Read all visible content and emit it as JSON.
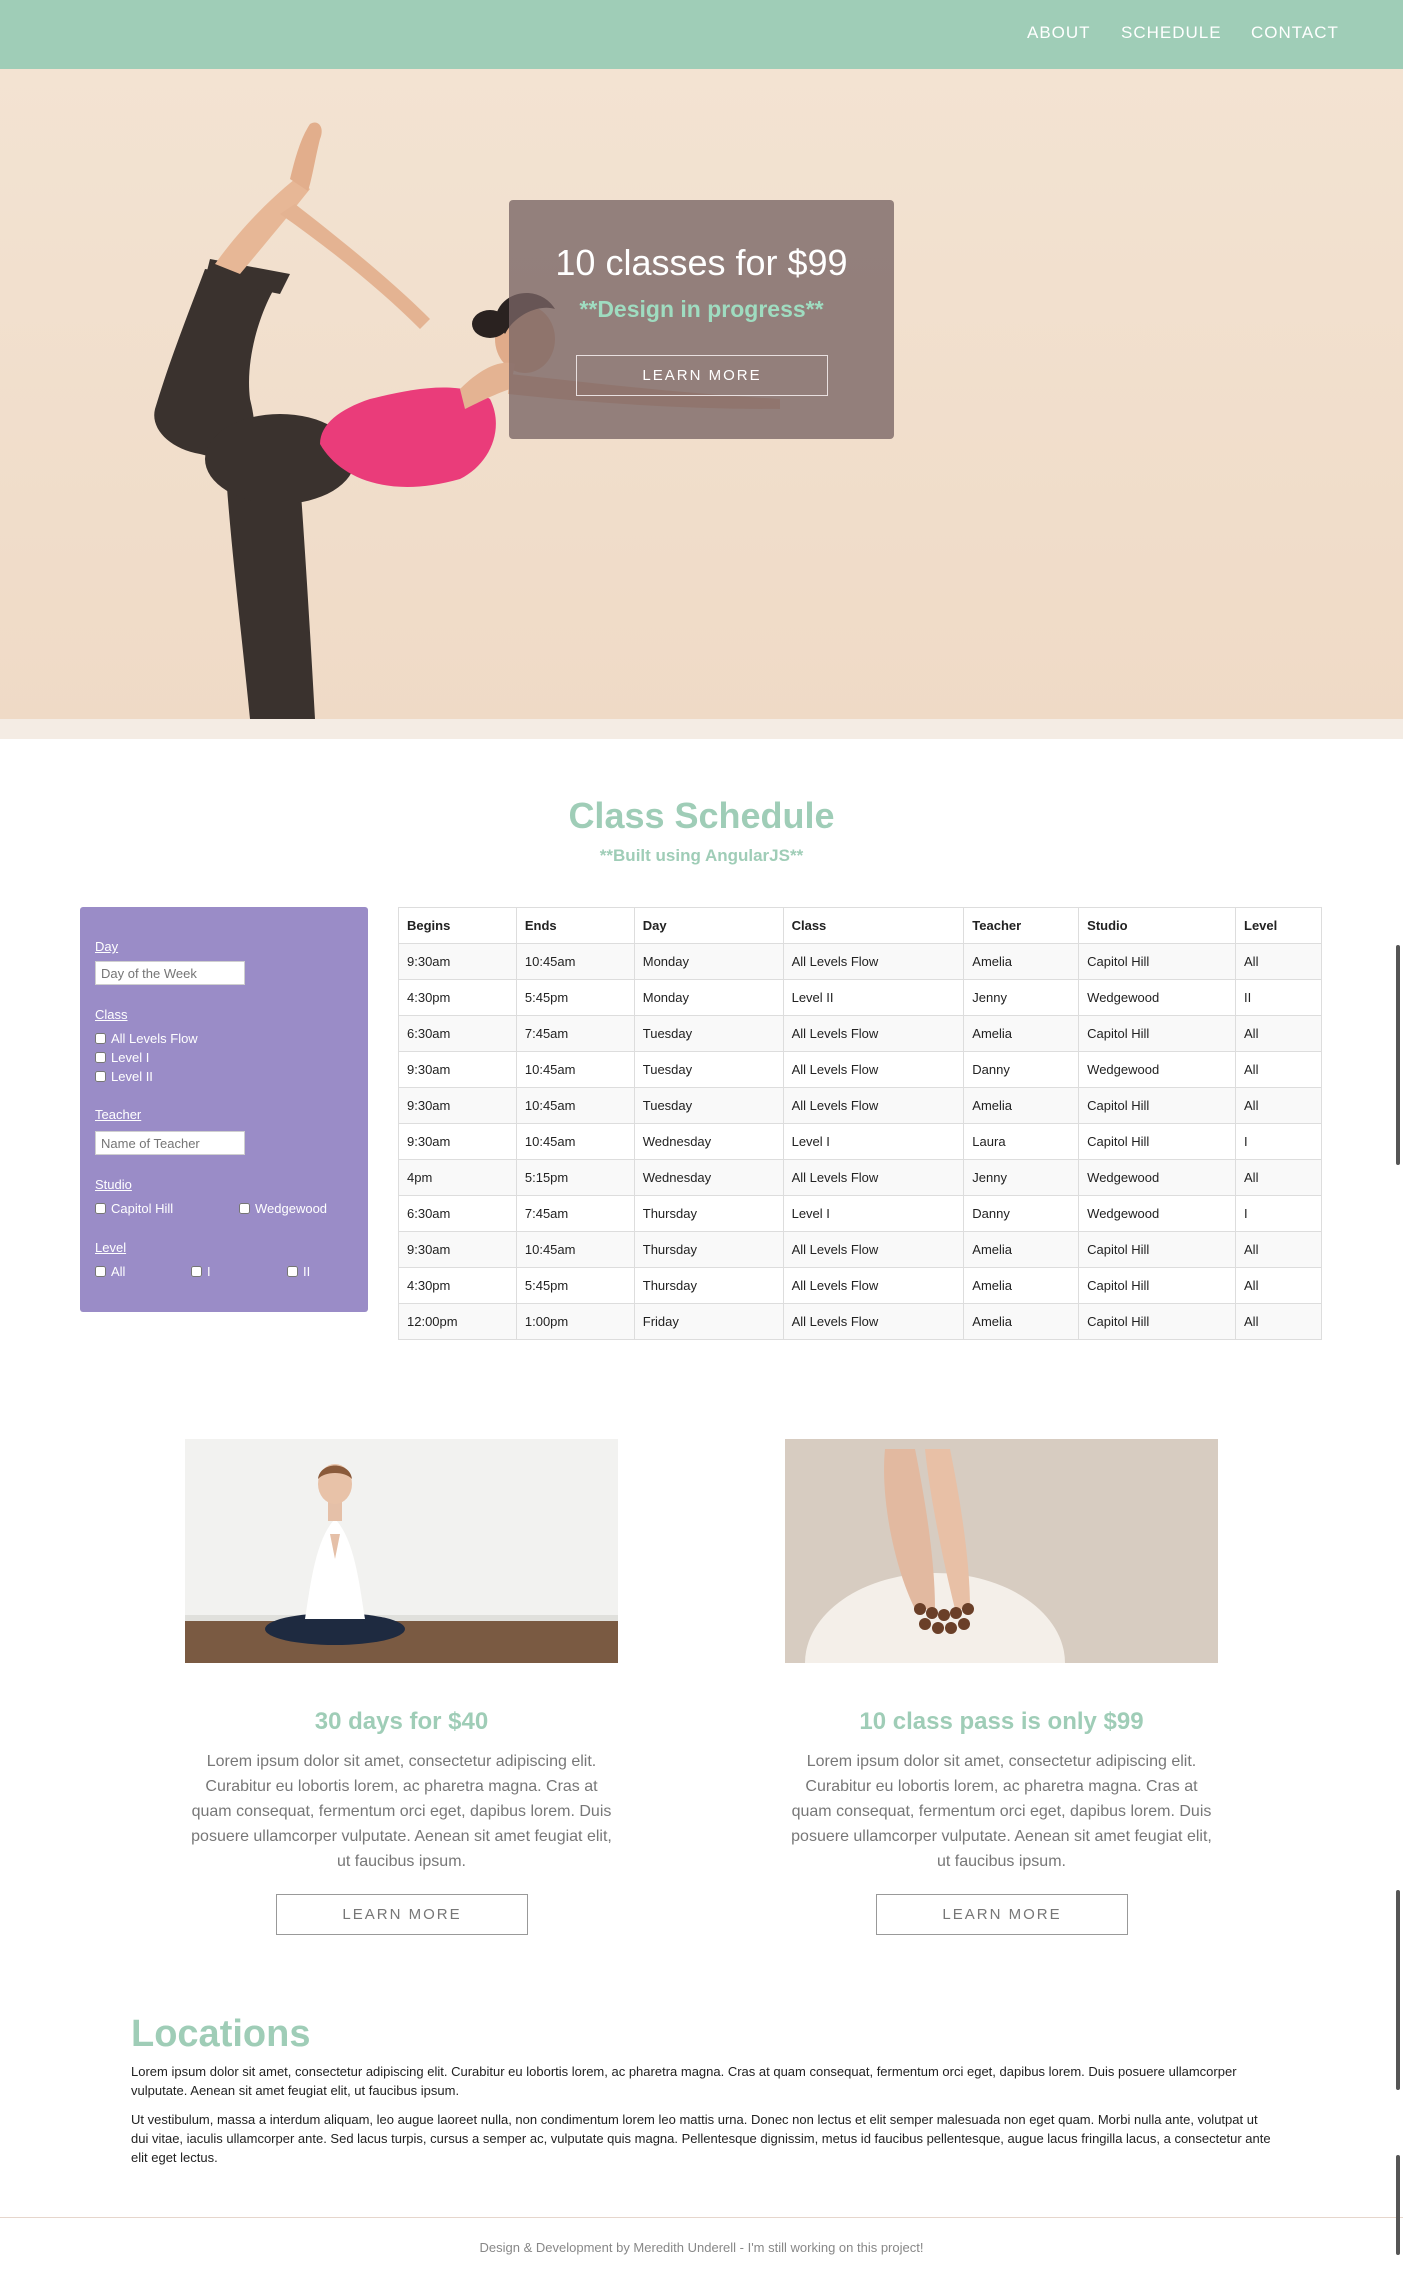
{
  "nav": {
    "items": [
      "ABOUT",
      "SCHEDULE",
      "CONTACT"
    ]
  },
  "hero": {
    "promo_title": "10 classes for $99",
    "promo_subtitle": "**Design in progress**",
    "promo_button": "LEARN MORE"
  },
  "schedule": {
    "title": "Class Schedule",
    "subtitle": "**Built using AngularJS**",
    "filters": {
      "day_label": "Day",
      "day_placeholder": "Day of the Week",
      "class_label": "Class",
      "class_options": [
        "All Levels Flow",
        "Level I",
        "Level II"
      ],
      "teacher_label": "Teacher",
      "teacher_placeholder": "Name of Teacher",
      "studio_label": "Studio",
      "studio_options": [
        "Capitol Hill",
        "Wedgewood"
      ],
      "level_label": "Level",
      "level_options": [
        "All",
        "I",
        "II"
      ]
    },
    "columns": [
      "Begins",
      "Ends",
      "Day",
      "Class",
      "Teacher",
      "Studio",
      "Level"
    ],
    "rows": [
      [
        "9:30am",
        "10:45am",
        "Monday",
        "All Levels Flow",
        "Amelia",
        "Capitol Hill",
        "All"
      ],
      [
        "4:30pm",
        "5:45pm",
        "Monday",
        "Level II",
        "Jenny",
        "Wedgewood",
        "II"
      ],
      [
        "6:30am",
        "7:45am",
        "Tuesday",
        "All Levels Flow",
        "Amelia",
        "Capitol Hill",
        "All"
      ],
      [
        "9:30am",
        "10:45am",
        "Tuesday",
        "All Levels Flow",
        "Danny",
        "Wedgewood",
        "All"
      ],
      [
        "9:30am",
        "10:45am",
        "Tuesday",
        "All Levels Flow",
        "Amelia",
        "Capitol Hill",
        "All"
      ],
      [
        "9:30am",
        "10:45am",
        "Wednesday",
        "Level I",
        "Laura",
        "Capitol Hill",
        "I"
      ],
      [
        "4pm",
        "5:15pm",
        "Wednesday",
        "All Levels Flow",
        "Jenny",
        "Wedgewood",
        "All"
      ],
      [
        "6:30am",
        "7:45am",
        "Thursday",
        "Level I",
        "Danny",
        "Wedgewood",
        "I"
      ],
      [
        "9:30am",
        "10:45am",
        "Thursday",
        "All Levels Flow",
        "Amelia",
        "Capitol Hill",
        "All"
      ],
      [
        "4:30pm",
        "5:45pm",
        "Thursday",
        "All Levels Flow",
        "Amelia",
        "Capitol Hill",
        "All"
      ],
      [
        "12:00pm",
        "1:00pm",
        "Friday",
        "All Levels Flow",
        "Amelia",
        "Capitol Hill",
        "All"
      ]
    ]
  },
  "offers": [
    {
      "title": "30 days for $40",
      "body": "Lorem ipsum dolor sit amet, consectetur adipiscing elit. Curabitur eu lobortis lorem, ac pharetra magna. Cras at quam consequat, fermentum orci eget, dapibus lorem. Duis posuere ullamcorper vulputate. Aenean sit amet feugiat elit, ut faucibus ipsum.",
      "button": "LEARN MORE"
    },
    {
      "title": "10 class pass is only $99",
      "body": "Lorem ipsum dolor sit amet, consectetur adipiscing elit. Curabitur eu lobortis lorem, ac pharetra magna. Cras at quam consequat, fermentum orci eget, dapibus lorem. Duis posuere ullamcorper vulputate. Aenean sit amet feugiat elit, ut faucibus ipsum.",
      "button": "LEARN MORE"
    }
  ],
  "locations": {
    "title": "Locations",
    "paragraphs": [
      "Lorem ipsum dolor sit amet, consectetur adipiscing elit. Curabitur eu lobortis lorem, ac pharetra magna. Cras at quam consequat, fermentum orci eget, dapibus lorem. Duis posuere ullamcorper vulputate. Aenean sit amet feugiat elit, ut faucibus ipsum.",
      "Ut vestibulum, massa a interdum aliquam, leo augue laoreet nulla, non condimentum lorem leo mattis urna. Donec non lectus et elit semper malesuada non eget quam. Morbi nulla ante, volutpat ut dui vitae, iaculis ullamcorper ante. Sed lacus turpis, cursus a semper ac, vulputate quis magna. Pellentesque dignissim, metus id faucibus pellentesque, augue lacus fringilla lacus, a consectetur ante elit eget lectus."
    ]
  },
  "footer": {
    "text": "Design & Development by Meredith Underell - I'm still working on this project!"
  },
  "colors": {
    "accent": "#9fcdb7",
    "filter_panel": "#9a8cc7",
    "promo_box": "#786464"
  }
}
